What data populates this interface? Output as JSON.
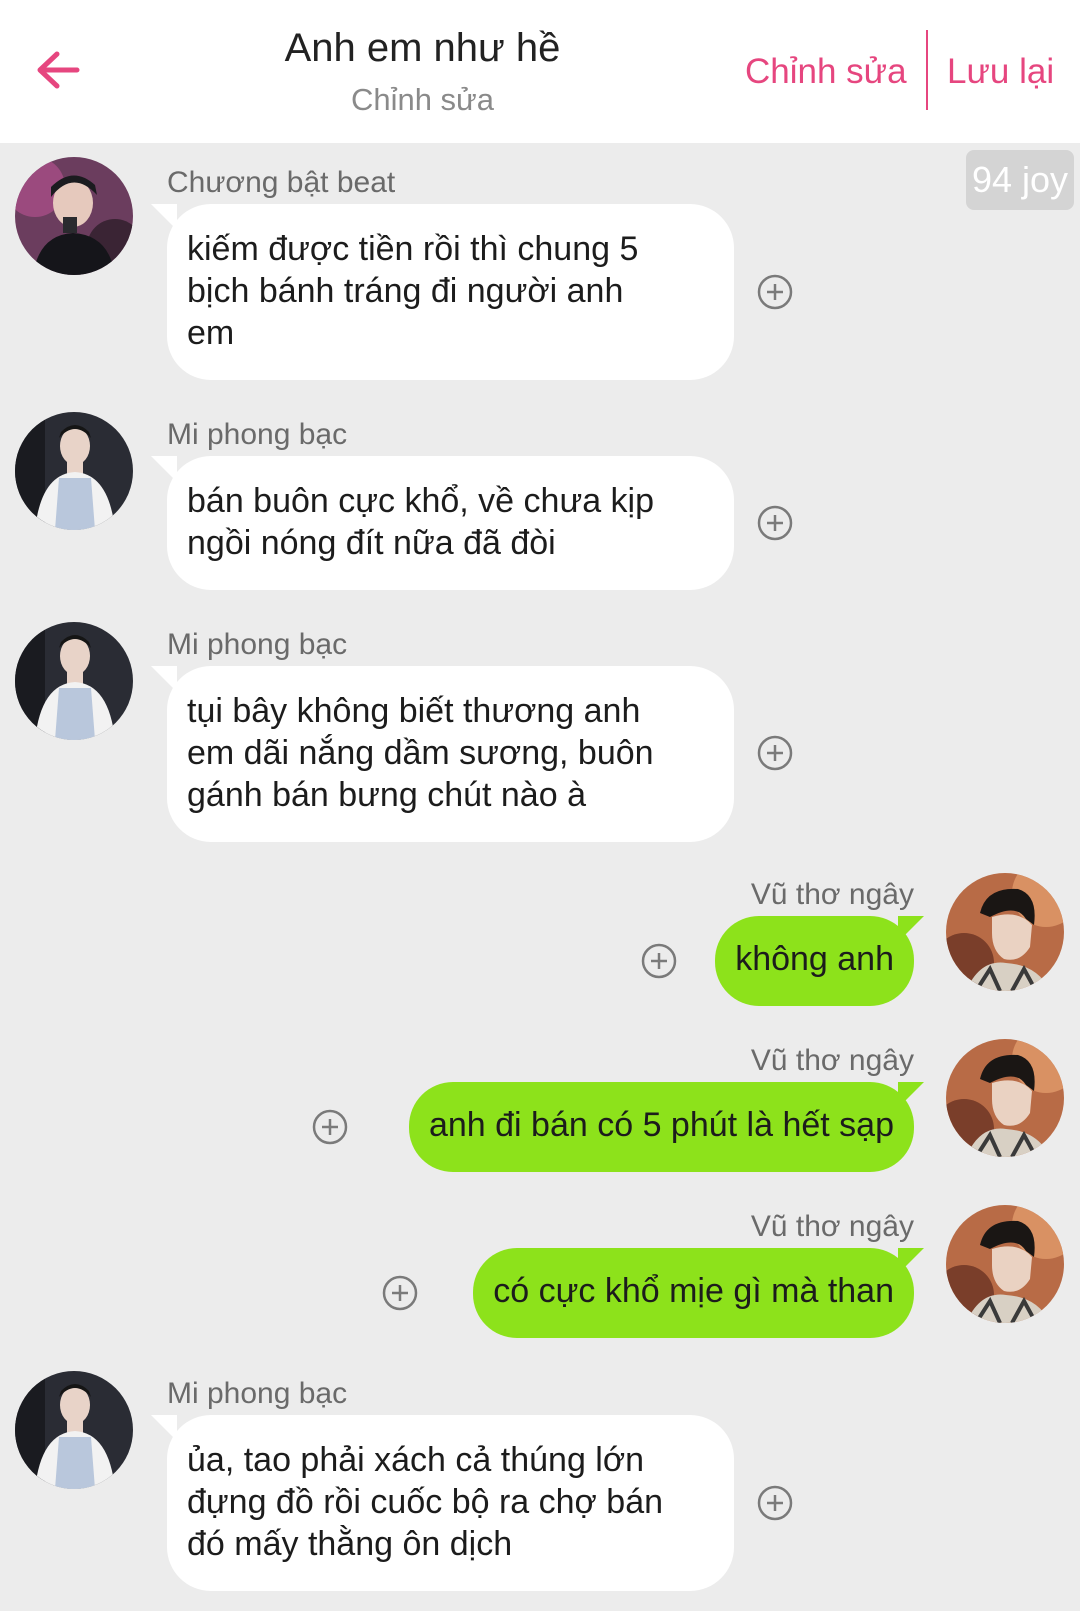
{
  "header": {
    "back_icon": "arrow-left-icon",
    "title": "Anh em như hề",
    "subtitle": "Chỉnh sửa",
    "edit_label": "Chỉnh sửa",
    "save_label": "Lưu lại",
    "accent_color": "#e6467f"
  },
  "badge": {
    "text": "94 joy"
  },
  "colors": {
    "background": "#ececec",
    "incoming_bubble": "#ffffff",
    "outgoing_bubble": "#8de21b"
  },
  "messages": [
    {
      "sender": "Chương bật beat",
      "side": "left",
      "lines": [
        "kiếm được tiền rồi thì chung 5",
        "bịch bánh tráng đi người anh",
        "em"
      ]
    },
    {
      "sender": "Mi phong bạc",
      "side": "left",
      "lines": [
        "bán buôn cực khổ, về chưa kịp",
        "ngồi nóng đít nữa đã đòi"
      ]
    },
    {
      "sender": "Mi phong bạc",
      "side": "left",
      "lines": [
        "tụi bây không biết thương anh",
        "em dãi nắng dầm sương, buôn",
        "gánh bán bưng chút nào à"
      ]
    },
    {
      "sender": "Vũ thơ ngây",
      "side": "right",
      "lines": [
        "không anh"
      ]
    },
    {
      "sender": "Vũ thơ ngây",
      "side": "right",
      "lines": [
        "anh đi bán có 5 phút là hết sạp"
      ]
    },
    {
      "sender": "Vũ thơ ngây",
      "side": "right",
      "lines": [
        "có cực khổ mịe gì mà than"
      ]
    },
    {
      "sender": "Mi phong bạc",
      "side": "left",
      "lines": [
        "ủa, tao phải xách cả thúng lớn",
        "đựng đồ rồi cuốc bộ ra chợ bán",
        "đó mấy thằng ôn dịch"
      ]
    }
  ]
}
